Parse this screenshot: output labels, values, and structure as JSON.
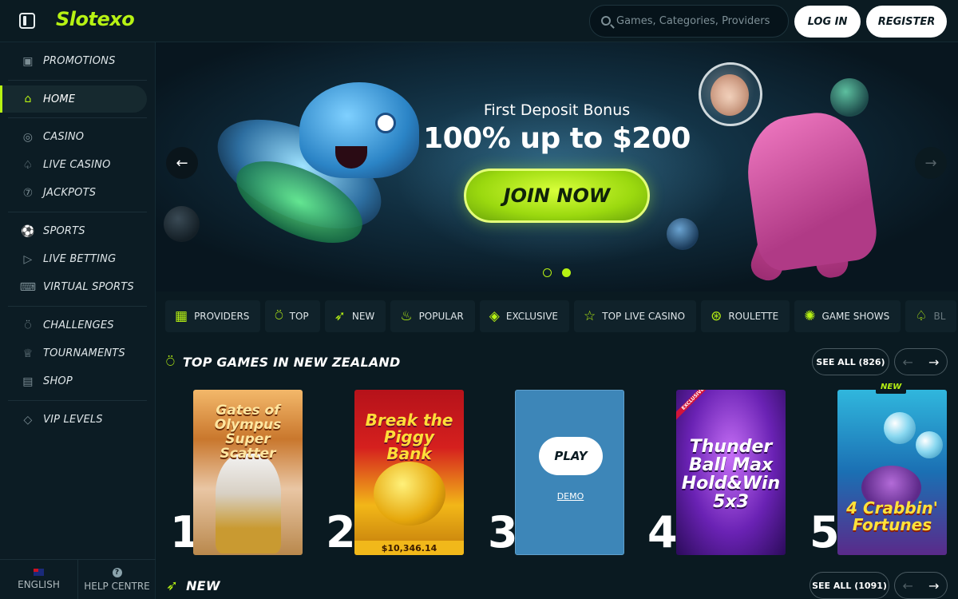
{
  "header": {
    "logo": "Slotexo",
    "search_placeholder": "Games, Categories, Providers",
    "login": "LOG IN",
    "register": "REGISTER"
  },
  "sidebar": {
    "groups": [
      [
        {
          "label": "PROMOTIONS",
          "icon": "gift-icon"
        }
      ],
      [
        {
          "label": "HOME",
          "icon": "home-icon",
          "active": true
        }
      ],
      [
        {
          "label": "CASINO",
          "icon": "chip-icon"
        },
        {
          "label": "LIVE CASINO",
          "icon": "spade-icon"
        },
        {
          "label": "JACKPOTS",
          "icon": "seven-icon"
        }
      ],
      [
        {
          "label": "SPORTS",
          "icon": "football-icon"
        },
        {
          "label": "LIVE BETTING",
          "icon": "play-icon"
        },
        {
          "label": "VIRTUAL SPORTS",
          "icon": "gamepad-icon"
        }
      ],
      [
        {
          "label": "CHALLENGES",
          "icon": "medal-icon"
        },
        {
          "label": "TOURNAMENTS",
          "icon": "trophy-icon"
        },
        {
          "label": "SHOP",
          "icon": "shop-icon"
        }
      ],
      [
        {
          "label": "VIP LEVELS",
          "icon": "diamond-icon"
        }
      ]
    ],
    "footer": {
      "language": "ENGLISH",
      "help": "HELP CENTRE"
    }
  },
  "banner": {
    "subtitle": "First Deposit Bonus",
    "title": "100% up to $200",
    "cta": "JOIN NOW",
    "slides_total": 2,
    "slide_active": 2
  },
  "categories": [
    {
      "label": "PROVIDERS",
      "icon": "grid-icon"
    },
    {
      "label": "TOP",
      "icon": "medal-icon"
    },
    {
      "label": "NEW",
      "icon": "rocket-icon"
    },
    {
      "label": "POPULAR",
      "icon": "flame-icon"
    },
    {
      "label": "EXCLUSIVE",
      "icon": "diamond-icon"
    },
    {
      "label": "TOP LIVE CASINO",
      "icon": "star-icon"
    },
    {
      "label": "ROULETTE",
      "icon": "roulette-icon"
    },
    {
      "label": "GAME SHOWS",
      "icon": "wheel-icon"
    },
    {
      "label": "BL",
      "icon": "spade-icon"
    }
  ],
  "top_games": {
    "title": "TOP GAMES IN NEW ZEALAND",
    "see_all": "SEE ALL (826)",
    "games": [
      {
        "rank": "1",
        "title": "Gates of Olympus Super Scatter"
      },
      {
        "rank": "2",
        "title": "Break the Piggy Bank",
        "jackpot": "$10,346.14"
      },
      {
        "rank": "3",
        "play": "PLAY",
        "demo": "DEMO"
      },
      {
        "rank": "4",
        "title": "Thunder Ball Max Hold&Win 5x3",
        "tag": "EXCLUSIVE"
      },
      {
        "rank": "5",
        "title": "4 Crabbin' Fortunes",
        "badge": "NEW"
      }
    ]
  },
  "new_section": {
    "title": "NEW",
    "see_all": "SEE ALL (1091)"
  }
}
